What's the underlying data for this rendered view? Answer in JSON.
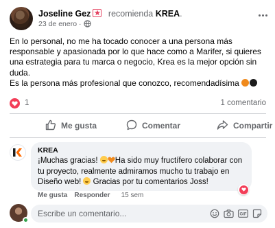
{
  "post": {
    "author": "Joseline Gez",
    "action": "recomienda",
    "target": "KREA",
    "date": "23 de enero",
    "body_line1": "En lo personal, no me ha tocado conocer a una persona más responsable y apasionada por lo que hace como a Marifer, si quieres una estrategia para tu marca o negocio, Krea es la mejor opción sin duda.",
    "body_line2": "Es la persona más profesional que conozco, recomendadísima",
    "reaction_count": "1",
    "comment_count": "1 comentario"
  },
  "actions": {
    "like": "Me gusta",
    "comment": "Comentar",
    "share": "Compartir"
  },
  "comment": {
    "author": "KREA",
    "text_part1": "¡Muchas gracias! ",
    "text_part2": "Ha sido muy fructífero colaborar con tu proyecto, realmente admiramos mucho tu trabajo en Diseño web! ",
    "text_part3": " Gracias por tu comentarios Joss!",
    "like_label": "Me gusta",
    "reply_label": "Responder",
    "time": "15 sem"
  },
  "reply_box": {
    "placeholder": "Escribe un comentario..."
  },
  "colors": {
    "accent_heart": "#f33e58",
    "secondary_text": "#65676b",
    "bubble_bg": "#f0f2f5",
    "online": "#31a24c"
  }
}
